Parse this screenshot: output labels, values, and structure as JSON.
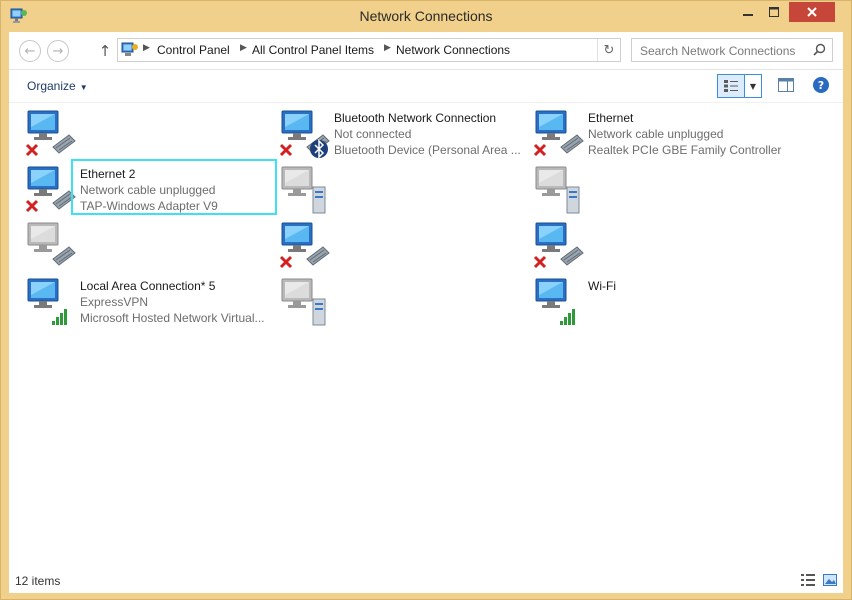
{
  "window": {
    "title": "Network Connections"
  },
  "address": {
    "crumbs": [
      "Control Panel",
      "All Control Panel Items",
      "Network Connections"
    ]
  },
  "search": {
    "placeholder": "Search Network Connections"
  },
  "toolbar": {
    "organize_label": "Organize"
  },
  "items": [
    {
      "name": "",
      "status": "",
      "device": "",
      "state": "disconnected"
    },
    {
      "name": "Bluetooth Network Connection",
      "status": "Not connected",
      "device": "Bluetooth Device (Personal Area ...",
      "state": "bluetooth"
    },
    {
      "name": "Ethernet",
      "status": "Network cable unplugged",
      "device": "Realtek PCIe GBE Family Controller",
      "state": "disconnected"
    },
    {
      "name": "Ethernet 2",
      "status": "Network cable unplugged",
      "device": "TAP-Windows Adapter V9",
      "state": "disconnected",
      "selected": true
    },
    {
      "name": "",
      "status": "",
      "device": "",
      "state": "server"
    },
    {
      "name": "",
      "status": "",
      "device": "",
      "state": "server"
    },
    {
      "name": "",
      "status": "",
      "device": "",
      "state": "gray"
    },
    {
      "name": "",
      "status": "",
      "device": "",
      "state": "disconnected"
    },
    {
      "name": "",
      "status": "",
      "device": "",
      "state": "disconnected"
    },
    {
      "name": "Local Area Connection* 5",
      "status": "ExpressVPN",
      "device": "Microsoft Hosted Network Virtual...",
      "state": "wifi"
    },
    {
      "name": "",
      "status": "",
      "device": "",
      "state": "server"
    },
    {
      "name": "Wi-Fi",
      "status": "",
      "device": "",
      "state": "wifi"
    }
  ],
  "status_bar": {
    "count": "12 items"
  },
  "colors": {
    "frame": "#f0d08a",
    "close": "#c7463a",
    "selection": "#3fe0f0"
  }
}
